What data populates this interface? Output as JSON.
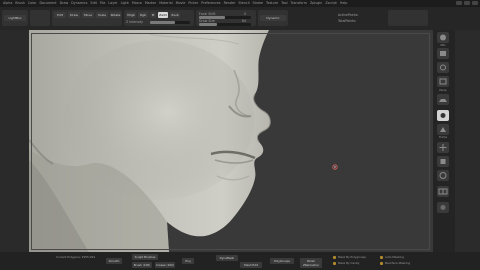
{
  "menu": {
    "items": [
      "Alpha",
      "Brush",
      "Color",
      "Document",
      "Draw",
      "Dynamics",
      "Edit",
      "File",
      "Layer",
      "Light",
      "Macro",
      "Marker",
      "Material",
      "Movie",
      "Picker",
      "Preferences",
      "Render",
      "Stencil",
      "Stroke",
      "Texture",
      "Tool",
      "Transform",
      "Zplugin",
      "Zscript",
      "Help"
    ]
  },
  "toolbar": {
    "history_label": "LightBox",
    "edit_label": "Edit",
    "draw_label": "Draw",
    "move_label": "Move",
    "scale_label": "Scale",
    "rotate_label": "Rotate",
    "mrgb_label": "Mrgb",
    "rgb_label": "Rgb",
    "m_label": "M",
    "zadd_label": "Zadd",
    "zsub_label": "Zsub",
    "focal_label": "Focal Shift",
    "focal_value": "0",
    "draw_size_label": "Draw Size",
    "draw_size_value": "64",
    "dynamic_label": "Dynamic",
    "active_points_label": "ActivePoints:",
    "total_points_label": "TotalPoints:",
    "rgb_intensity_label": "Rgb Intensity",
    "z_intensity_label": "Z Intensity",
    "z_intensity_fill": 0.62,
    "focal_fill": 0.5,
    "draw_size_fill": 0.35,
    "info_line": "RECORDINGS IN"
  },
  "rightpanel": {
    "spix_label": "SPix",
    "persp_label": "Persp",
    "floor_label": "Floor",
    "frame_label": "Frame",
    "move_label": "Move",
    "scale_label": "Scale",
    "rotate_label": "Rotate",
    "polyf_label": "PolyF",
    "transp_label": "Transp",
    "solo_label": "Solo"
  },
  "bottombar": {
    "subtool_label": "Current Polygons: 2955,094",
    "button1": "Smooth",
    "button2": "Sculpt Brushes",
    "button3": "Brush (100)",
    "button4": "Crease (100)",
    "button5": "Proj",
    "button6": "DynaMesh",
    "button7": "Mesh Edit",
    "button8": "PolyGroups",
    "button9": "Polish",
    "button10": "ZRemesher",
    "option1": "Mask By Polygroups",
    "option2": "Mask By Cavity",
    "option3": "Auto Masking",
    "option4": "Backface Masking"
  },
  "colors": {
    "accent": "#b08a2e",
    "canvas": "#393939",
    "model": "#bdbcb4"
  }
}
